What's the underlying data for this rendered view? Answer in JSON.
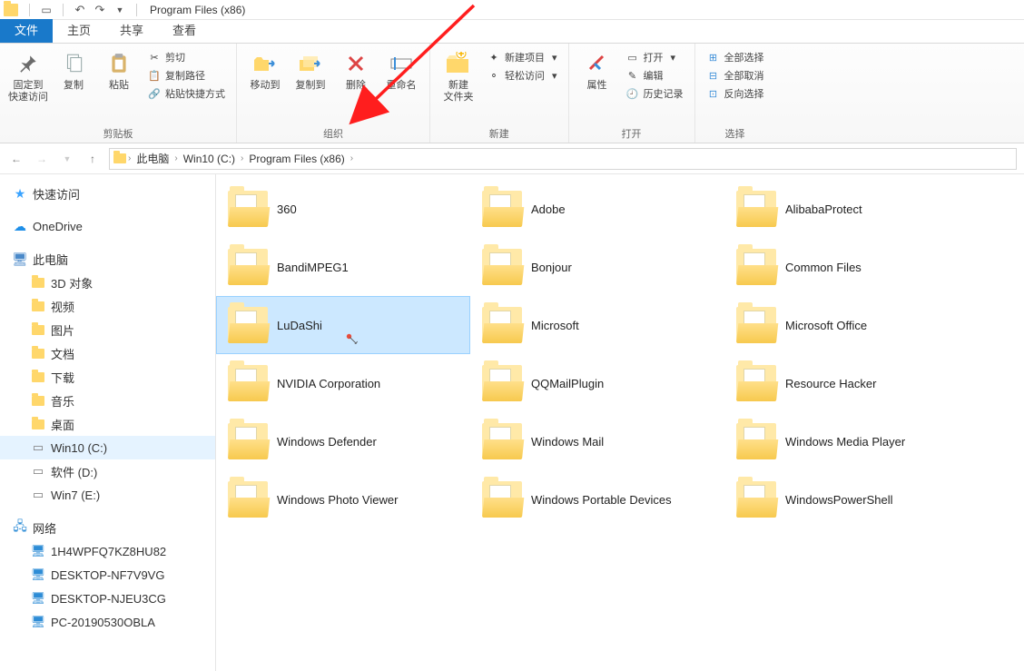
{
  "title": "Program Files (x86)",
  "tabs": {
    "file": "文件",
    "home": "主页",
    "share": "共享",
    "view": "查看"
  },
  "ribbon": {
    "clipboard": {
      "pinLabel": "固定到\n快速访问",
      "copyLabel": "复制",
      "pasteLabel": "粘贴",
      "cut": "剪切",
      "copyPath": "复制路径",
      "pasteShortcut": "粘贴快捷方式",
      "groupLabel": "剪贴板"
    },
    "organize": {
      "moveTo": "移动到",
      "copyTo": "复制到",
      "delete": "删除",
      "rename": "重命名",
      "groupLabel": "组织"
    },
    "new": {
      "newFolder": "新建\n文件夹",
      "newItem": "新建项目",
      "easyAccess": "轻松访问",
      "groupLabel": "新建"
    },
    "open": {
      "properties": "属性",
      "open": "打开",
      "edit": "编辑",
      "history": "历史记录",
      "groupLabel": "打开"
    },
    "select": {
      "selectAll": "全部选择",
      "selectNone": "全部取消",
      "invert": "反向选择",
      "groupLabel": "选择"
    }
  },
  "breadcrumb": {
    "pc": "此电脑",
    "drive": "Win10 (C:)",
    "folder": "Program Files (x86)"
  },
  "sidebar": {
    "quick": "快速访问",
    "onedrive": "OneDrive",
    "pc": "此电脑",
    "pcItems": {
      "objects3d": "3D 对象",
      "videos": "视频",
      "pictures": "图片",
      "docs": "文档",
      "downloads": "下载",
      "music": "音乐",
      "desktop": "桌面",
      "c": "Win10 (C:)",
      "d": "软件 (D:)",
      "e": "Win7 (E:)"
    },
    "network": "网络",
    "netItems": {
      "n1": "1H4WPFQ7KZ8HU82",
      "n2": "DESKTOP-NF7V9VG",
      "n3": "DESKTOP-NJEU3CG",
      "n4": "PC-20190530OBLA"
    }
  },
  "folders": {
    "f0": "360",
    "f1": "Adobe",
    "f2": "AlibabaProtect",
    "f3": "BandiMPEG1",
    "f4": "Bonjour",
    "f5": "Common Files",
    "f6": "LuDaShi",
    "f7": "Microsoft",
    "f8": "Microsoft Office",
    "f9": "NVIDIA Corporation",
    "f10": "QQMailPlugin",
    "f11": "Resource Hacker",
    "f12": "Windows Defender",
    "f13": "Windows Mail",
    "f14": "Windows Media Player",
    "f15": "Windows Photo Viewer",
    "f16": "Windows Portable Devices",
    "f17": "WindowsPowerShell"
  },
  "selectedFolder": "LuDaShi"
}
